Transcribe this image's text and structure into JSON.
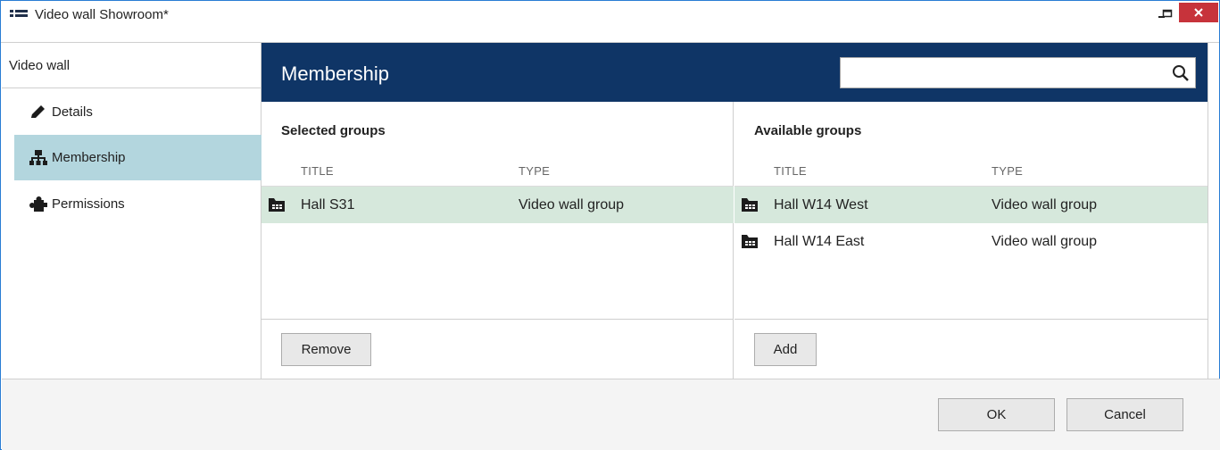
{
  "window": {
    "title": "Video wall Showroom*",
    "app_icon": "list-icon",
    "controls": {
      "minimize": "minimize-icon",
      "maximize": "maximize-icon",
      "close": "close-icon"
    },
    "colors": {
      "border": "#2a7dd4",
      "close_bg": "#c7333b"
    }
  },
  "sidebar": {
    "header": "Video wall",
    "items": [
      {
        "label": "Details",
        "icon": "pencil-icon",
        "active": false
      },
      {
        "label": "Membership",
        "icon": "hierarchy-icon",
        "active": true
      },
      {
        "label": "Permissions",
        "icon": "puzzle-icon",
        "active": false
      }
    ],
    "active_color": "#b3d6de"
  },
  "main": {
    "title": "Membership",
    "header_color": "#0f3566",
    "search": {
      "value": "",
      "placeholder": "",
      "icon": "search-icon"
    },
    "selected": {
      "title": "Selected groups",
      "columns": [
        "TITLE",
        "TYPE"
      ],
      "rows": [
        {
          "title": "Hall S31",
          "type": "Video wall group",
          "icon": "folder-icon",
          "selected": true
        }
      ],
      "button": "Remove"
    },
    "available": {
      "title": "Available groups",
      "columns": [
        "TITLE",
        "TYPE"
      ],
      "rows": [
        {
          "title": "Hall W14 West",
          "type": "Video wall group",
          "icon": "folder-icon",
          "selected": true
        },
        {
          "title": "Hall W14 East",
          "type": "Video wall group",
          "icon": "folder-icon",
          "selected": false
        }
      ],
      "button": "Add"
    },
    "selected_row_color": "#d6e8dc"
  },
  "footer": {
    "ok": "OK",
    "cancel": "Cancel"
  }
}
